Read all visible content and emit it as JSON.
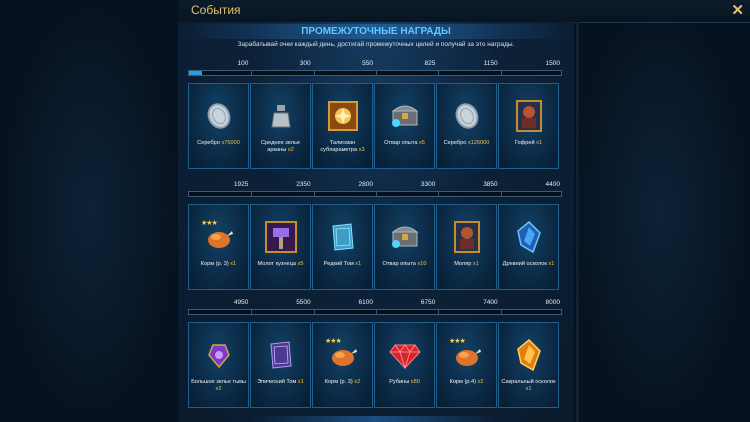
{
  "window": {
    "title": "События"
  },
  "panel": {
    "heading": "ПРОМЕЖУТОЧНЫЕ НАГРАДЫ",
    "subtitle": "Зарабатывай очки каждый день, достигай промежуточных целей и получай за это награды."
  },
  "progress": {
    "current_fraction_tier1": 0.015
  },
  "tiers": [
    {
      "thresholds": [
        "100",
        "300",
        "550",
        "825",
        "1150",
        "1500"
      ],
      "rewards": [
        {
          "name": "Серебро",
          "qty": "x75000",
          "icon": "silver-coin-icon"
        },
        {
          "name": "Среднее зелье арканы",
          "qty": "x2",
          "icon": "arcane-potion-icon"
        },
        {
          "name": "Талисман субпараметра",
          "qty": "x3",
          "icon": "talisman-icon"
        },
        {
          "name": "Отвар опыта",
          "qty": "x5",
          "icon": "xp-brew-chest-icon"
        },
        {
          "name": "Серебро",
          "qty": "x125000",
          "icon": "silver-coin-icon"
        },
        {
          "name": "Гофрей",
          "qty": "x1",
          "icon": "champion-card-icon"
        }
      ]
    },
    {
      "thresholds": [
        "1925",
        "2350",
        "2800",
        "3300",
        "3850",
        "4400"
      ],
      "rewards": [
        {
          "name": "Корм (р. 3)",
          "qty": "x1",
          "icon": "food-chicken-icon"
        },
        {
          "name": "Молот кузнеца",
          "qty": "x5",
          "icon": "smith-hammer-icon"
        },
        {
          "name": "Редкий Том",
          "qty": "x1",
          "icon": "rare-tome-icon"
        },
        {
          "name": "Отвар опыта",
          "qty": "x10",
          "icon": "xp-brew-chest-icon"
        },
        {
          "name": "Моляр",
          "qty": "x1",
          "icon": "champion-card-icon"
        },
        {
          "name": "Древний осколок",
          "qty": "x1",
          "icon": "ancient-shard-icon"
        }
      ]
    },
    {
      "thresholds": [
        "4950",
        "5500",
        "6100",
        "6750",
        "7400",
        "8000"
      ],
      "rewards": [
        {
          "name": "Большое зелье тьмы",
          "qty": "x2",
          "icon": "void-potion-icon"
        },
        {
          "name": "Эпический Том",
          "qty": "x1",
          "icon": "epic-tome-icon"
        },
        {
          "name": "Корм (р. 3)",
          "qty": "x2",
          "icon": "food-chicken-icon"
        },
        {
          "name": "Рубины",
          "qty": "x80",
          "icon": "ruby-gem-icon"
        },
        {
          "name": "Корм (р.4)",
          "qty": "x2",
          "icon": "food-chicken-icon"
        },
        {
          "name": "Сакральный осколок",
          "qty": "x1",
          "icon": "sacred-shard-icon"
        }
      ]
    }
  ],
  "colors": {
    "accent": "#e8c06a",
    "heading": "#5ec8ff",
    "qty": "#f0c040",
    "card_border": "#1e5f8e"
  }
}
